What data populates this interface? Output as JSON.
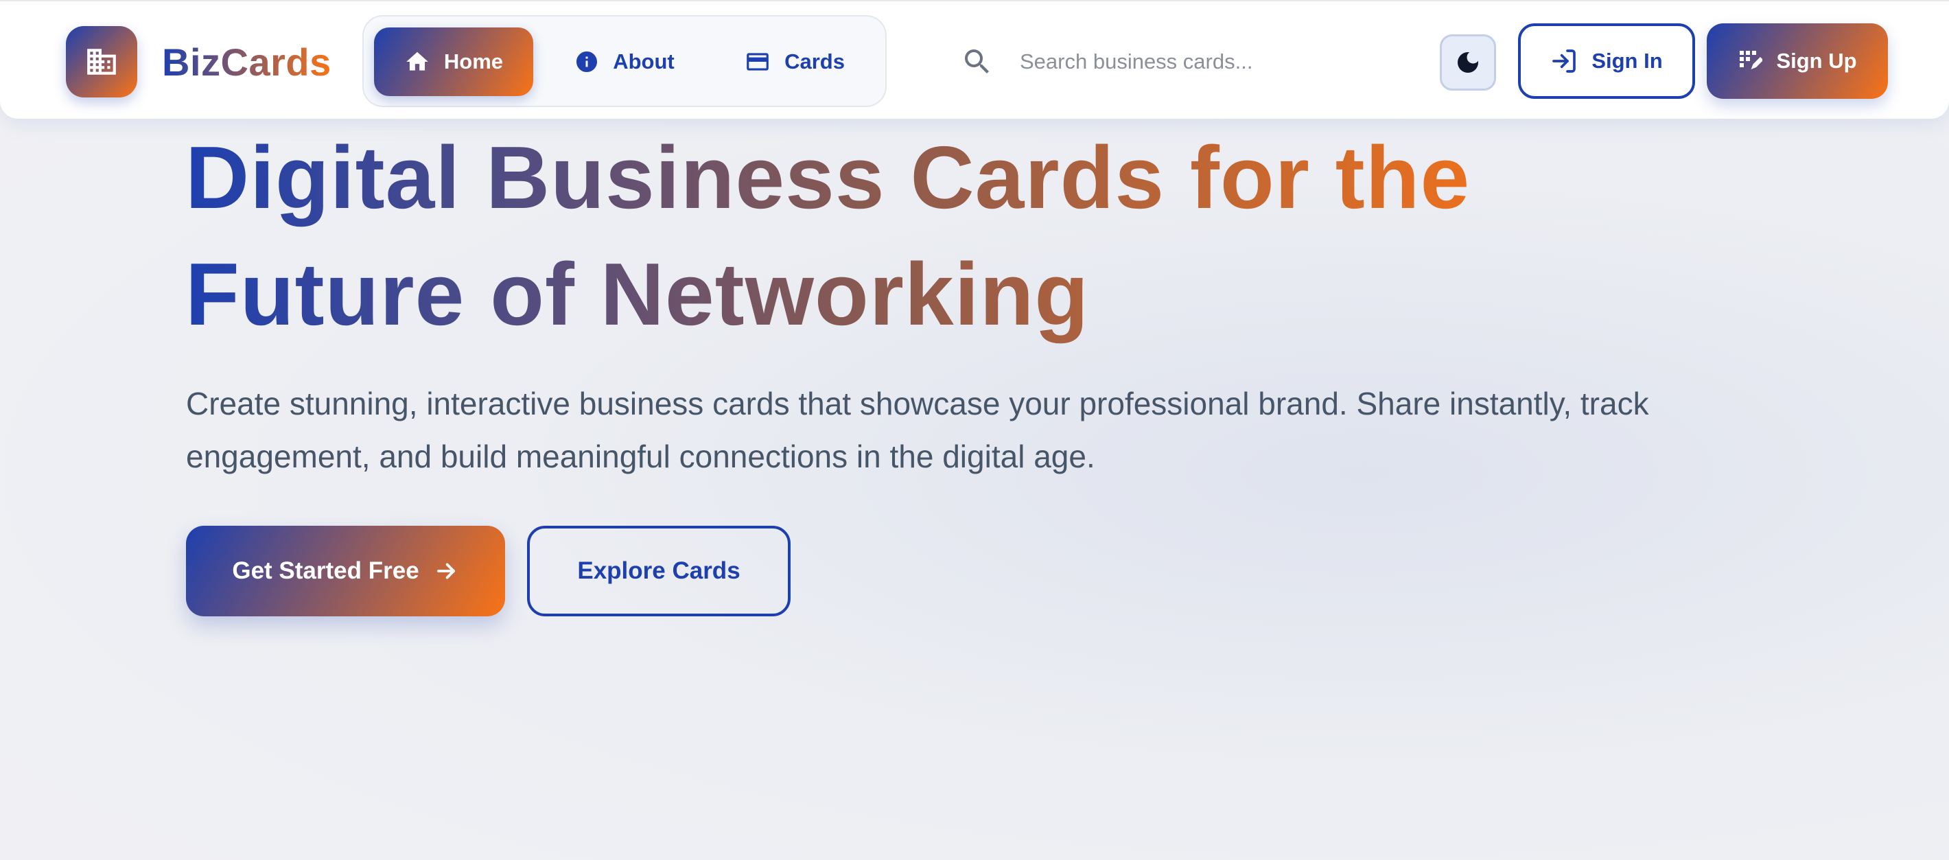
{
  "brand": {
    "name": "BizCards",
    "logo_icon": "building-icon"
  },
  "nav": {
    "items": [
      {
        "label": "Home",
        "icon": "home-icon",
        "active": true
      },
      {
        "label": "About",
        "icon": "info-icon",
        "active": false
      },
      {
        "label": "Cards",
        "icon": "credit-card-icon",
        "active": false
      }
    ]
  },
  "search": {
    "placeholder": "Search business cards...",
    "value": "",
    "icon": "search-icon"
  },
  "theme_toggle": {
    "icon": "moon-icon"
  },
  "auth": {
    "signin_label": "Sign In",
    "signin_icon": "login-icon",
    "signup_label": "Sign Up",
    "signup_icon": "signup-icon"
  },
  "hero": {
    "title_line1": "Digital Business Cards for the",
    "title_line2": "Future of Networking",
    "subtitle": "Create stunning, interactive business cards that showcase your professional brand. Share instantly, track engagement, and build meaningful connections in the digital age.",
    "cta_primary": "Get Started Free",
    "cta_secondary": "Explore Cards"
  },
  "colors": {
    "primary": "#1e40af",
    "accent": "#f97316",
    "text_muted": "#475569"
  }
}
